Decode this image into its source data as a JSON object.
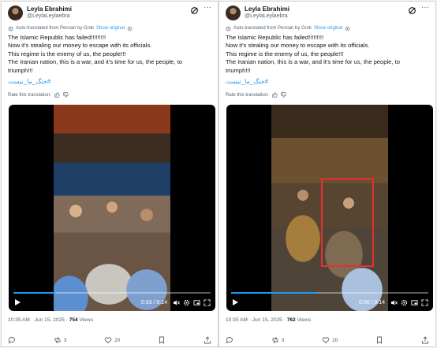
{
  "posts": [
    {
      "author_name": "Leyla Ebrahimi",
      "author_handle": "@LeylaLeylaebra",
      "translated_label": "Auto-translated from Persian by Grok",
      "show_original": "Show original",
      "lines": [
        "The Islamic Republic has failed!!!!!!!!!",
        "Now it's stealing our money to escape with its officials.",
        "This regime is the enemy of us, the people!!!",
        "The Iranian nation, this is a war, and it's time for us, the people, to",
        "triumph!!!"
      ],
      "hashtag": "#جنگ_ما_نیست",
      "rate_label": "Rate this translation:",
      "video_time": "0:03 / 0:14",
      "video_progress": 0.21,
      "post_time": "10:35 AM · Jun 15, 2025 · ",
      "views_count": "754",
      "views_label": " Views",
      "reposts": "3",
      "likes": "20"
    },
    {
      "author_name": "Leyla Ebrahimi",
      "author_handle": "@LeylaLeylaebra",
      "translated_label": "Auto-translated from Persian by Grok",
      "show_original": "Show original",
      "lines": [
        "The Islamic Republic has failed!!!!!!!!!",
        "Now it's stealing our money to escape with its officials.",
        "This regime is the enemy of us, the people!!!",
        "The Iranian nation, this is a war, and it's time for us, the people, to",
        "triumph!!!"
      ],
      "hashtag": "#جنگ_ما_نیست",
      "rate_label": "Rate this translation:",
      "video_time": "0:06 / 0:14",
      "video_progress": 0.43,
      "post_time": "10:35 AM · Jun 15, 2025 · ",
      "views_count": "762",
      "views_label": " Views",
      "reposts": "3",
      "likes": "20"
    }
  ],
  "colors": {
    "link": "#1d9bf0",
    "muted": "#536471",
    "highlight_box": "#e3312f"
  },
  "icons": [
    "grok-icon",
    "more-icon",
    "gear-icon",
    "thumbs-up-icon",
    "thumbs-down-icon",
    "play-icon",
    "volume-icon",
    "settings-icon",
    "fullscreen-icon",
    "reply-icon",
    "repost-icon",
    "like-icon",
    "bookmark-icon",
    "share-icon"
  ]
}
